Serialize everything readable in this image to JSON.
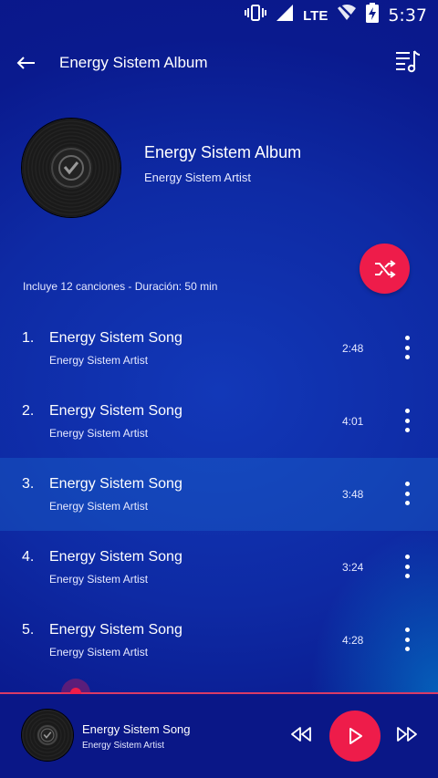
{
  "status_bar": {
    "network": "LTE",
    "time": "5:37",
    "icons": [
      "vibrate-icon",
      "signal-icon",
      "wifi-off-icon",
      "battery-charging-icon"
    ]
  },
  "app_bar": {
    "title": "Energy Sistem Album",
    "back_icon": "arrow-left-icon",
    "queue_icon": "playlist-music-icon"
  },
  "album": {
    "title": "Energy Sistem Album",
    "artist": "Energy Sistem Artist",
    "info": "Incluye 12 canciones - Duración: 50 min",
    "shuffle_icon": "shuffle-icon"
  },
  "songs": [
    {
      "num": "1.",
      "title": "Energy Sistem Song",
      "artist": "Energy Sistem Artist",
      "duration": "2:48"
    },
    {
      "num": "2.",
      "title": "Energy Sistem Song",
      "artist": "Energy Sistem Artist",
      "duration": "4:01"
    },
    {
      "num": "3.",
      "title": "Energy Sistem Song",
      "artist": "Energy Sistem Artist",
      "duration": "3:48"
    },
    {
      "num": "4.",
      "title": "Energy Sistem Song",
      "artist": "Energy Sistem Artist",
      "duration": "3:24"
    },
    {
      "num": "5.",
      "title": "Energy Sistem Song",
      "artist": "Energy Sistem Artist",
      "duration": "4:28"
    }
  ],
  "highlighted_song_index": 2,
  "player": {
    "title": "Energy Sistem Song",
    "artist": "Energy Sistem Artist",
    "progress": 0.17,
    "icons": [
      "rewind-icon",
      "play-icon",
      "fast-forward-icon"
    ]
  },
  "colors": {
    "background": "#0b1a8c",
    "accent": "#ee1c4a",
    "text": "#ffffff"
  }
}
